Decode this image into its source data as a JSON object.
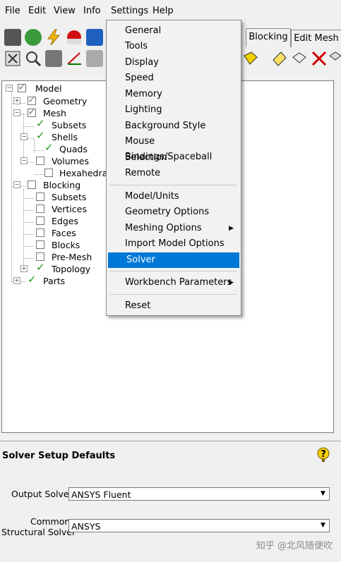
{
  "menubar": {
    "items": [
      "File",
      "Edit",
      "View",
      "Info",
      "Settings",
      "Help"
    ]
  },
  "tabs": [
    "Blocking",
    "Edit Mesh"
  ],
  "tree": {
    "model": "Model",
    "geometry": "Geometry",
    "mesh": "Mesh",
    "subsets": "Subsets",
    "shells": "Shells",
    "quads": "Quads",
    "volumes": "Volumes",
    "hexahedra": "Hexahedra",
    "blocking": "Blocking",
    "b_subsets": "Subsets",
    "vertices": "Vertices",
    "edges": "Edges",
    "faces": "Faces",
    "blocks": "Blocks",
    "premesh": "Pre-Mesh",
    "topology": "Topology",
    "parts": "Parts"
  },
  "settings_menu": {
    "group1": [
      "General",
      "Tools",
      "Display",
      "Speed",
      "Memory",
      "Lighting",
      "Background Style",
      "Mouse Bindings/Spaceball",
      "Selection",
      "Remote"
    ],
    "group2": [
      "Model/Units",
      "Geometry Options",
      "Meshing Options",
      "Import Model Options",
      "Solver"
    ],
    "group3": [
      "Workbench Parameters"
    ],
    "group4": [
      "Reset"
    ],
    "selected": "Solver"
  },
  "solver_panel": {
    "title": "Solver Setup Defaults",
    "output_label": "Output Solver",
    "output_value": "ANSYS Fluent",
    "common_label_1": "Common",
    "common_label_2": "Structural Solver",
    "common_value": "ANSYS"
  },
  "watermark": "知乎 @北风随便吹",
  "colors": {
    "selection": "#0078d7",
    "check": "#1a9a1a",
    "help_icon": "#e8c000"
  }
}
